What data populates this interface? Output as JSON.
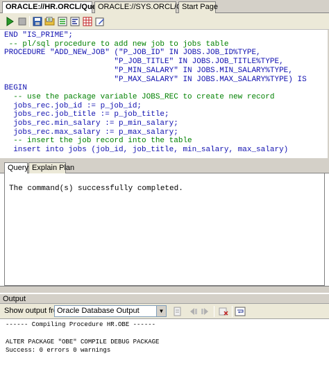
{
  "doc_tabs": [
    {
      "label": "ORACLE://HR.ORCL/Query"
    },
    {
      "label": "ORACLE://SYS.ORCL/Query"
    },
    {
      "label": "Start Page"
    }
  ],
  "toolbar_icons": [
    "run-icon",
    "stop-icon",
    "save-icon",
    "open-icon",
    "explain-plan-icon",
    "format-icon",
    "grid-icon",
    "edit-icon"
  ],
  "editor": {
    "lines": [
      {
        "t": "END \"IS_PRIME\";",
        "c": "kw"
      },
      {
        "t": " -- pl/sql procedure to add new job to jobs table",
        "c": "cm"
      },
      {
        "t": "PROCEDURE \"ADD_NEW_JOB\" (\"P_JOB_ID\" IN JOBS.JOB_ID%TYPE,",
        "c": "kw"
      },
      {
        "t": "                        \"P_JOB_TITLE\" IN JOBS.JOB_TITLE%TYPE,",
        "c": "kw"
      },
      {
        "t": "                        \"P_MIN_SALARY\" IN JOBS.MIN_SALARY%TYPE,",
        "c": "kw"
      },
      {
        "t": "                        \"P_MAX_SALARY\" IN JOBS.MAX_SALARY%TYPE) IS",
        "c": "kw"
      },
      {
        "t": "BEGIN",
        "c": "kw"
      },
      {
        "t": "  -- use the package variable JOBS_REC to create new record",
        "c": "cm"
      },
      {
        "t": "  jobs_rec.job_id := p_job_id;",
        "c": "id"
      },
      {
        "t": "  jobs_rec.job_title := p_job_title;",
        "c": "id"
      },
      {
        "t": "  jobs_rec.min_salary := p_min_salary;",
        "c": "id"
      },
      {
        "t": "  jobs_rec.max_salary := p_max_salary;",
        "c": "id"
      },
      {
        "t": "  -- insert the job record into the table",
        "c": "cm"
      },
      {
        "t": "  insert into jobs (job_id, job_title, min_salary, max_salary)",
        "c": "kw"
      }
    ]
  },
  "bottom_tabs": [
    {
      "label": "Query"
    },
    {
      "label": "Explain Plan"
    }
  ],
  "results": {
    "message": "The command(s) successfully completed."
  },
  "output": {
    "title": "Output",
    "show_from_label": "Show output from:",
    "selected_source": "Oracle Database Output",
    "lines": [
      "------ Compiling Procedure HR.OBE ------",
      "",
      "ALTER PACKAGE \"OBE\" COMPILE DEBUG PACKAGE",
      "Success: 0 errors 0 warnings"
    ]
  }
}
